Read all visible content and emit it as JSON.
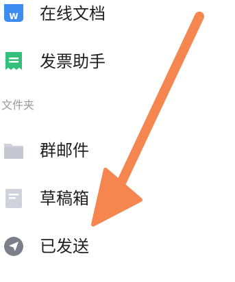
{
  "menu": {
    "items_top": [
      {
        "label": "在线文档",
        "icon": "online-doc-icon",
        "color": "#3f8cf0"
      },
      {
        "label": "发票助手",
        "icon": "invoice-icon",
        "color": "#34c07a"
      }
    ],
    "folders_header": "文件夹",
    "folders": [
      {
        "label": "群邮件",
        "icon": "folder-icon",
        "color": "#cfd2da"
      },
      {
        "label": "草稿箱",
        "icon": "draft-icon",
        "color": "#cfd2da"
      },
      {
        "label": "已发送",
        "icon": "sent-icon",
        "color": "#7a7f8a"
      }
    ]
  },
  "overlay": {
    "arrow_icon": "arrow-annotation-icon",
    "arrow_color": "#f5864f"
  },
  "colors": {
    "text": "#1f1f1f",
    "section_header": "#9a9a9a",
    "background": "#ffffff"
  }
}
